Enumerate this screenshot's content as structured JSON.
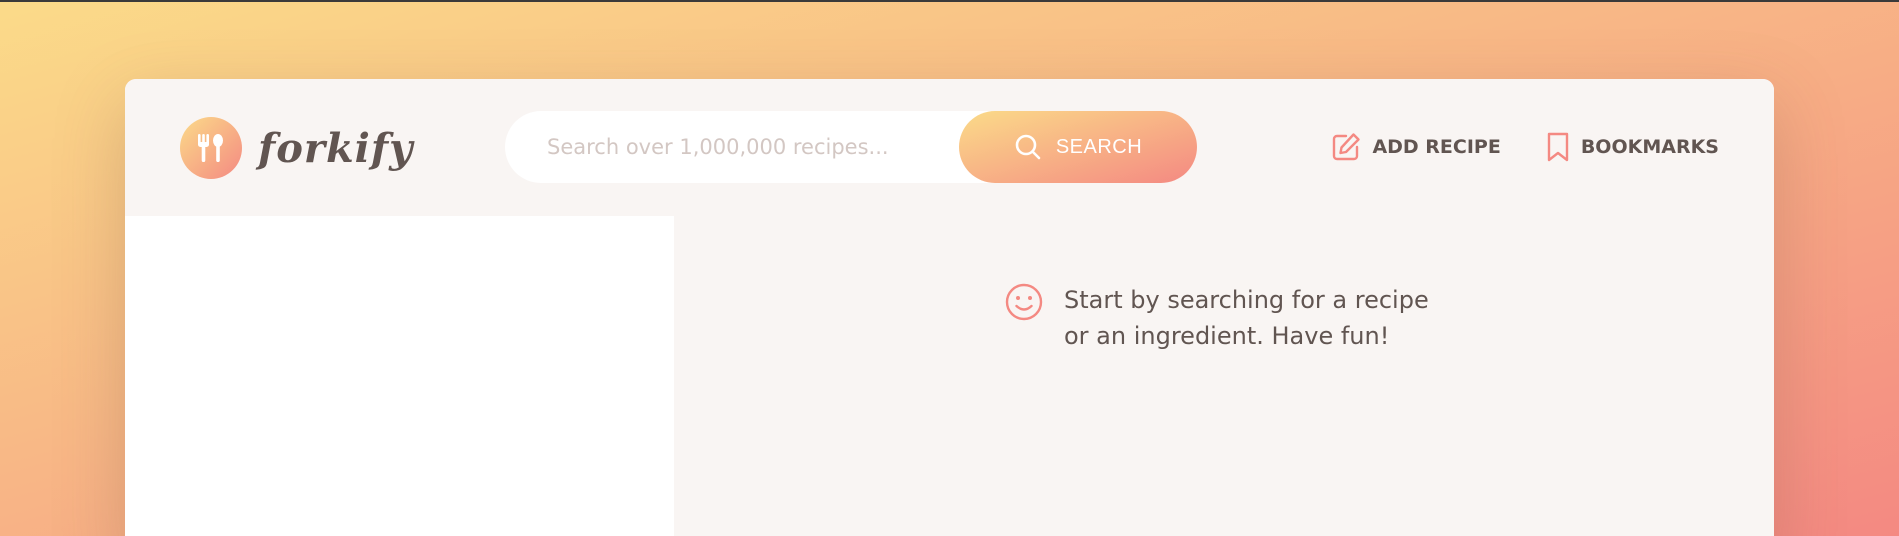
{
  "app": {
    "name": "forkify"
  },
  "search": {
    "placeholder": "Search over 1,000,000 recipes...",
    "button_label": "SEARCH"
  },
  "nav": {
    "items": [
      {
        "label": "ADD RECIPE",
        "icon": "edit-icon"
      },
      {
        "label": "BOOKMARKS",
        "icon": "bookmark-icon"
      }
    ]
  },
  "recipe": {
    "message": "Start by searching for a recipe or an ingredient. Have fun!",
    "message_icon": "smile-icon"
  },
  "colors": {
    "gradient_start": "#fbdb89",
    "gradient_end": "#f48982",
    "text_primary": "#615551",
    "panel_bg": "#f9f5f3",
    "placeholder": "#d3c7c3"
  }
}
